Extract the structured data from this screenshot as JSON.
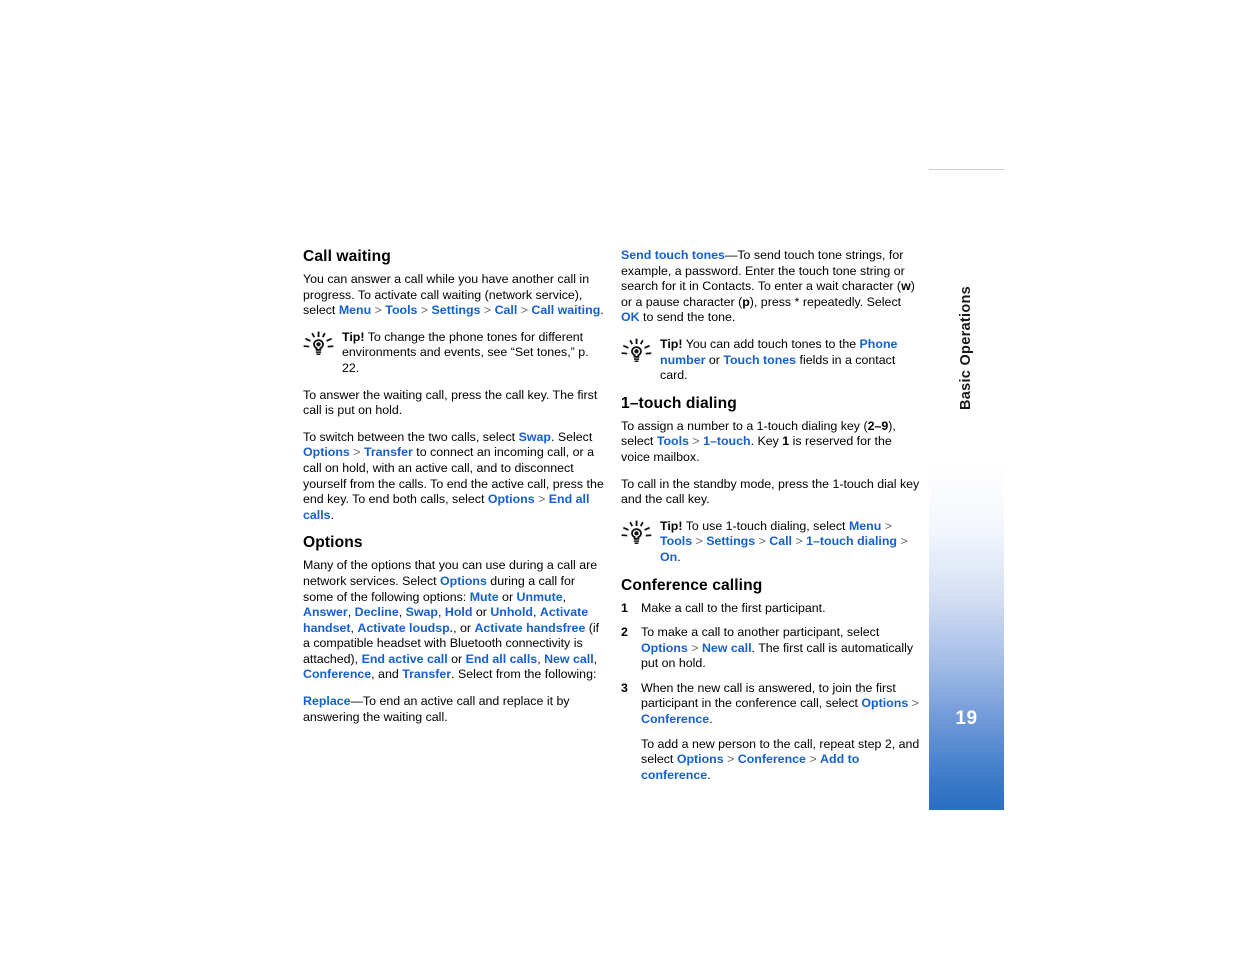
{
  "sidebar": {
    "chapter_label": "Basic Operations",
    "page_number": "19",
    "gradient_top_color": "#ffffff",
    "gradient_bottom_color": "#2a6fc0"
  },
  "link_color": "#1660cc",
  "left_column": {
    "heading_call_waiting": "Call waiting",
    "p1_part1": "You can answer a call while you have another call in progress. To activate call waiting (network service), select ",
    "p1_link1": "Menu",
    "p1_sep1": " > ",
    "p1_link2": "Tools",
    "p1_sep2": " > ",
    "p1_link3": "Settings",
    "p1_sep3": " > ",
    "p1_link4": "Call",
    "p1_sep4": " > ",
    "p1_link5": "Call waiting",
    "p1_end": ".",
    "tip1_lead": "Tip!",
    "tip1_text": " To change the phone tones for different environments and events, see “Set tones,” p. 22.",
    "p2": "To answer the waiting call, press the call key. The first call is put on hold.",
    "p3_part1": "To switch between the two calls, select ",
    "p3_link1": "Swap",
    "p3_part2": ". Select ",
    "p3_link2": "Options",
    "p3_sep1": " > ",
    "p3_link3": "Transfer",
    "p3_part3": " to connect an incoming call, or a call on hold, with an active call, and to disconnect yourself from the calls. To end the active call, press the end key. To end both calls, select ",
    "p3_link4": "Options",
    "p3_sep2": " > ",
    "p3_link5": "End all calls",
    "p3_end": ".",
    "heading_options": "Options",
    "p4_part1": "Many of the options that you can use during a call are network services. Select ",
    "p4_link1": "Options",
    "p4_part2": " during a call for some of the following options: ",
    "p4_link2": "Mute",
    "p4_part3": " or ",
    "p4_link3": "Unmute",
    "p4_part4": ", ",
    "p4_link4": "Answer",
    "p4_part5": ", ",
    "p4_link5": "Decline",
    "p4_part6": ", ",
    "p4_link6": "Swap",
    "p4_part7": ", ",
    "p4_link7": "Hold",
    "p4_part8": " or ",
    "p4_link8": "Unhold",
    "p4_part9": ", ",
    "p4_link9": "Activate handset",
    "p4_part10": ", ",
    "p4_link10": "Activate loudsp.",
    "p4_part11": ", or ",
    "p4_link11": "Activate handsfree",
    "p4_part12": " (if a compatible headset with Bluetooth connectivity is attached), ",
    "p4_link12": "End active call",
    "p4_part13": " or ",
    "p4_link13": "End all calls",
    "p4_part14": ", ",
    "p4_link14": "New call",
    "p4_part15": ", ",
    "p4_link15": "Conference",
    "p4_part16": ", and ",
    "p4_link16": "Transfer",
    "p4_end": ". Select from the following:",
    "p5_link1": "Replace",
    "p5_text": "—To end an active call and replace it by answering the waiting call."
  },
  "right_column": {
    "p1_link1": "Send touch tones",
    "p1_part1": "—To send touch tone strings, for example, a password. Enter the touch tone string or search for it in Contacts. To enter a wait character (",
    "p1_bold1": "w",
    "p1_part2": ") or a pause character (",
    "p1_bold2": "p",
    "p1_part3": "), press * repeatedly. Select ",
    "p1_link2": "OK",
    "p1_end": " to send the tone.",
    "tip1_lead": "Tip!",
    "tip1_part1": " You can add touch tones to the ",
    "tip1_link1": "Phone number",
    "tip1_part2": " or ",
    "tip1_link2": "Touch tones",
    "tip1_end": " fields in a contact card.",
    "heading_1touch": "1–touch dialing",
    "p2_part1": "To assign a number to a 1-touch dialing key (",
    "p2_bold1": "2–9",
    "p2_part2": "), select ",
    "p2_link1": "Tools",
    "p2_sep1": " > ",
    "p2_link2": "1–touch",
    "p2_part3": ". Key ",
    "p2_bold2": "1",
    "p2_end": " is reserved for the voice mailbox.",
    "p3": "To call in the standby mode, press the 1-touch dial key and the call key.",
    "tip2_lead": "Tip!",
    "tip2_part1": " To use 1-touch dialing, select ",
    "tip2_link1": "Menu",
    "tip2_sep1": " > ",
    "tip2_link2": "Tools",
    "tip2_sep2": " > ",
    "tip2_link3": "Settings",
    "tip2_sep3": " > ",
    "tip2_link4": "Call",
    "tip2_sep4": " > ",
    "tip2_link5": "1–touch dialing",
    "tip2_sep5": " > ",
    "tip2_link6": "On",
    "tip2_end": ".",
    "heading_conference": "Conference calling",
    "step1_num": "1",
    "step1_text": "Make a call to the first participant.",
    "step2_num": "2",
    "step2_part1": "To make a call to another participant, select ",
    "step2_link1": "Options",
    "step2_sep1": " > ",
    "step2_link2": "New call",
    "step2_end": ". The first call is automatically put on hold.",
    "step3_num": "3",
    "step3_part1": "When the new call is answered, to join the first participant in the conference call, select ",
    "step3_link1": "Options",
    "step3_sep1": " > ",
    "step3_link2": "Conference",
    "step3_end": ".",
    "step3_sub_part1": "To add a new person to the call, repeat step 2, and select ",
    "step3_sub_link1": "Options",
    "step3_sub_sep1": " > ",
    "step3_sub_link2": "Conference",
    "step3_sub_sep2": " > ",
    "step3_sub_link3": "Add to conference",
    "step3_sub_end": "."
  }
}
